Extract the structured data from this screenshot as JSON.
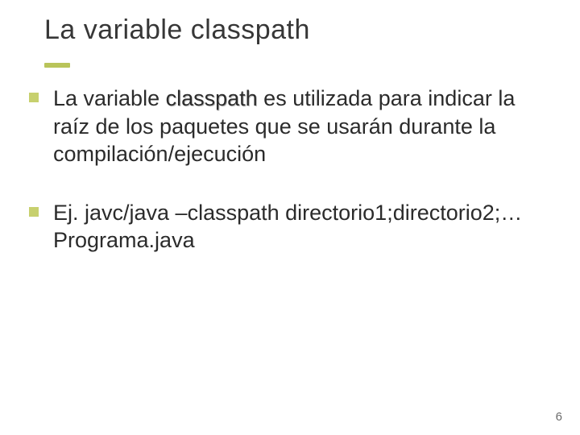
{
  "slide": {
    "title": "La variable classpath",
    "bullets": [
      {
        "pre": "La variable ",
        "keyword": "classpath",
        "post": " es utilizada para indicar la raíz de los paquetes que se usarán durante la compilación/ejecución"
      },
      {
        "pre": "Ej. javc/java –classpath directorio1;directorio2;… Programa.java",
        "keyword": "",
        "post": ""
      }
    ],
    "page_number": "6"
  },
  "colors": {
    "accent": "#b9c45a",
    "bullet": "#c7d06e"
  }
}
